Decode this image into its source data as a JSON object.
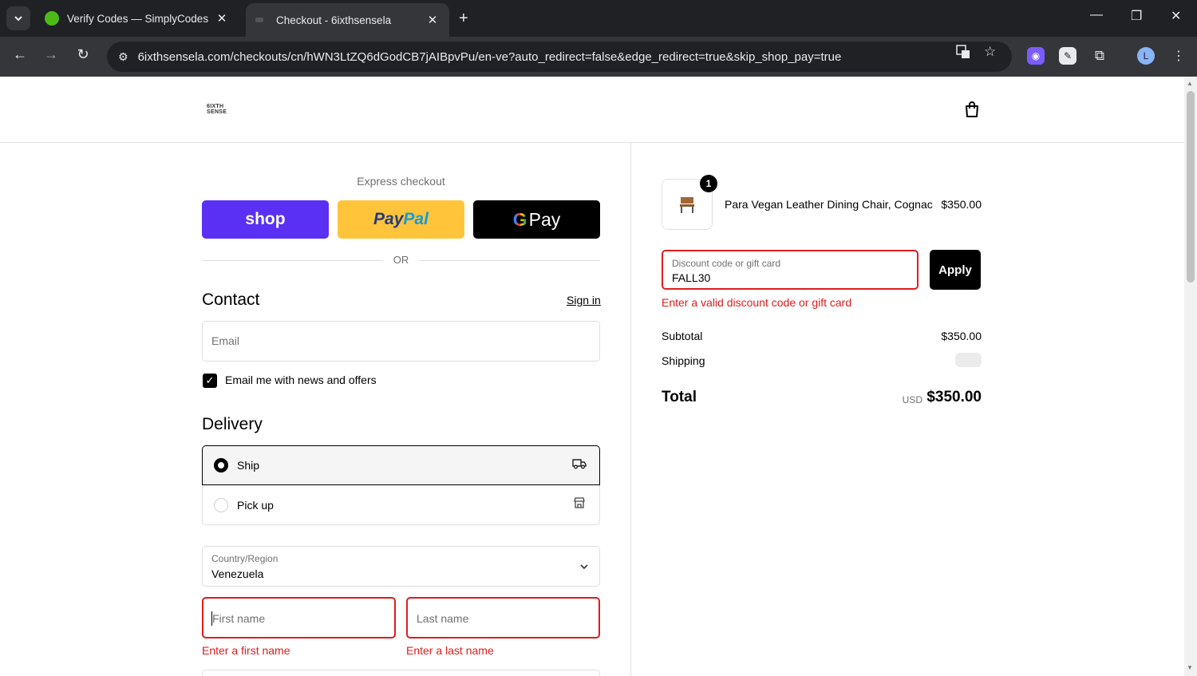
{
  "browser": {
    "tabs": [
      {
        "title": "Verify Codes — SimplyCodes",
        "active": false
      },
      {
        "title": "Checkout - 6ixthsensela",
        "active": true
      }
    ],
    "url": "6ixthsensela.com/checkouts/cn/hWN3LtZQ6dGodCB7jAIBpvPu/en-ve?auto_redirect=false&edge_redirect=true&skip_shop_pay=true",
    "profile_initial": "L"
  },
  "header": {
    "logo_line1": "6IXTH",
    "logo_line2": "SENSE"
  },
  "express": {
    "label": "Express checkout",
    "shop_label": "shop",
    "paypal_pay": "Pay",
    "paypal_pal": "Pal",
    "gpay_g": "G",
    "gpay_label": "Pay",
    "or_label": "OR"
  },
  "contact": {
    "title": "Contact",
    "signin_label": "Sign in",
    "email_placeholder": "Email",
    "newsletter_label": "Email me with news and offers",
    "newsletter_checked": true
  },
  "delivery": {
    "title": "Delivery",
    "options": [
      {
        "label": "Ship",
        "selected": true
      },
      {
        "label": "Pick up",
        "selected": false
      }
    ],
    "country_label": "Country/Region",
    "country_value": "Venezuela",
    "first_name_placeholder": "First name",
    "last_name_placeholder": "Last name",
    "first_name_error": "Enter a first name",
    "last_name_error": "Enter a last name"
  },
  "order": {
    "quantity": "1",
    "product_name": "Para Vegan Leather Dining Chair, Cognac",
    "product_price": "$350.00",
    "discount_label": "Discount code or gift card",
    "discount_value": "FALL30",
    "apply_label": "Apply",
    "discount_error": "Enter a valid discount code or gift card",
    "subtotal_label": "Subtotal",
    "subtotal_value": "$350.00",
    "shipping_label": "Shipping",
    "total_label": "Total",
    "total_currency": "USD",
    "total_value": "$350.00"
  },
  "colors": {
    "shop_purple": "#5a31f4",
    "paypal_yellow": "#ffc439",
    "error_red": "#dd1d1d"
  }
}
